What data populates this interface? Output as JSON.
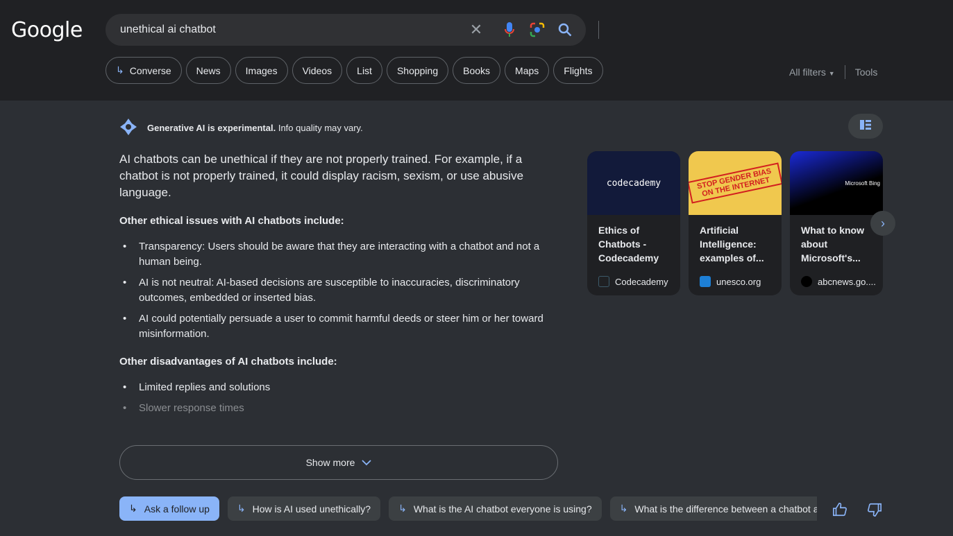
{
  "header": {
    "logo": "Google",
    "query": "unethical ai chatbot",
    "chips": [
      "Converse",
      "News",
      "Images",
      "Videos",
      "List",
      "Shopping",
      "Books",
      "Maps",
      "Flights"
    ],
    "all_filters": "All filters",
    "tools": "Tools"
  },
  "ai": {
    "notice_bold": "Generative AI is experimental.",
    "notice_rest": " Info quality may vary.",
    "lead": "AI chatbots can be unethical if they are not properly trained. For example, if a chatbot is not properly trained, it could display racism, sexism, or use abusive language.",
    "section1": "Other ethical issues with AI chatbots include:",
    "items1": [
      "Transparency: Users should be aware that they are interacting with a chatbot and not a human being.",
      "AI is not neutral: AI-based decisions are susceptible to inaccuracies, discriminatory outcomes, embedded or inserted bias.",
      "AI could potentially persuade a user to commit harmful deeds or steer him or her toward misinformation."
    ],
    "section2": "Other disadvantages of AI chatbots include:",
    "items2": [
      "Limited replies and solutions",
      "Slower response times"
    ],
    "show_more": "Show more"
  },
  "cards": [
    {
      "title": "Ethics of Chatbots - Codecademy",
      "source": "Codecademy",
      "thumb_text": "codecademy"
    },
    {
      "title": "Artificial Intelligence: examples of...",
      "source": "unesco.org",
      "thumb_text": "STOP GENDER BIAS ON THE INTERNET"
    },
    {
      "title": "What to know about Microsoft's...",
      "source": "abcnews.go....",
      "thumb_text": "Microsoft Bing"
    }
  ],
  "followups": [
    "Ask a follow up",
    "How is AI used unethically?",
    "What is the AI chatbot everyone is using?",
    "What is the difference between a chatbot and AI?"
  ],
  "colors": {
    "accent": "#8ab4f8",
    "header_bg": "#202124",
    "body_bg": "#2c2f34"
  }
}
